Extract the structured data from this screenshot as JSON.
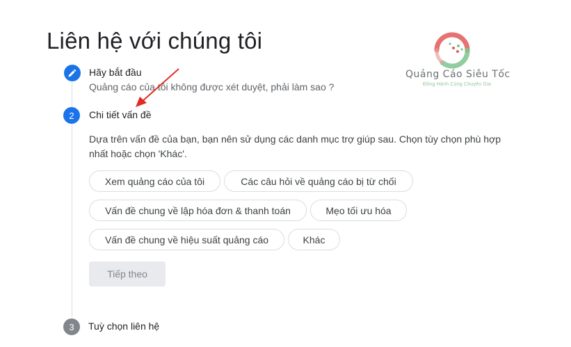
{
  "page": {
    "title": "Liên hệ với chúng tôi"
  },
  "steps": [
    {
      "number": "",
      "icon": "pencil-icon",
      "title": "Hãy bắt đầu",
      "subtitle": "Quảng cáo của tôi không được xét duyệt, phải làm sao ?"
    },
    {
      "number": "2",
      "title": "Chi tiết vấn đề",
      "description": "Dựa trên vấn đề của bạn, bạn nên sử dụng các danh mục trợ giúp sau. Chọn tùy chọn phù hợp nhất hoặc chọn 'Khác'."
    },
    {
      "number": "3",
      "title": "Tuỳ chọn liên hệ"
    }
  ],
  "options": [
    "Xem quảng cáo của tôi",
    "Các câu hỏi về quảng cáo bị từ chối",
    "Vấn đề chung về lập hóa đơn & thanh toán",
    "Mẹo tối ưu hóa",
    "Vấn đề chung về hiệu suất quảng cáo",
    "Khác"
  ],
  "next_button": "Tiếp theo",
  "logo": {
    "name": "Quảng Cáo Siêu Tốc",
    "tagline": "Đồng Hành Cùng Chuyên Gia",
    "colors": {
      "red": "#e05a5a",
      "green": "#7cc48e"
    }
  },
  "colors": {
    "accent": "#1a73e8",
    "inactive_step": "#80868b",
    "annotation_arrow": "#e02b20"
  }
}
